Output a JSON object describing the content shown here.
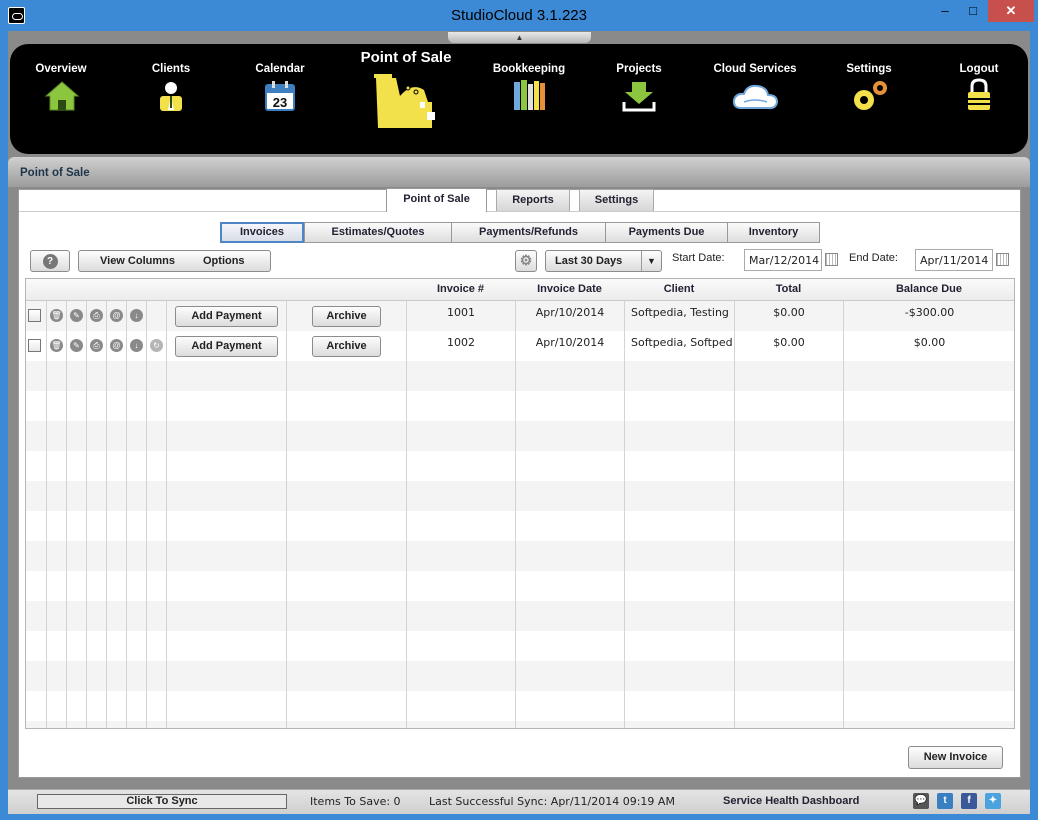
{
  "window": {
    "title": "StudioCloud 3.1.223",
    "minimize": "–",
    "maximize": "□",
    "close": "✕"
  },
  "nav": {
    "collapse_glyph": "▲",
    "items": [
      {
        "label": "Overview",
        "icon": "home-icon"
      },
      {
        "label": "Clients",
        "icon": "client-person-icon"
      },
      {
        "label": "Calendar",
        "icon": "calendar-icon",
        "day": "23"
      },
      {
        "label": "Point of Sale",
        "icon": "cash-register-icon",
        "active": true
      },
      {
        "label": "Bookkeeping",
        "icon": "books-icon"
      },
      {
        "label": "Projects",
        "icon": "download-tray-icon"
      },
      {
        "label": "Cloud Services",
        "icon": "cloud-icon"
      },
      {
        "label": "Settings",
        "icon": "gears-icon"
      },
      {
        "label": "Logout",
        "icon": "padlock-icon"
      }
    ]
  },
  "section": {
    "title": "Point of Sale"
  },
  "tabs": [
    {
      "label": "Point of Sale",
      "active": true
    },
    {
      "label": "Reports"
    },
    {
      "label": "Settings"
    }
  ],
  "subtabs": [
    {
      "label": "Invoices",
      "active": true
    },
    {
      "label": "Estimates/Quotes"
    },
    {
      "label": "Payments/Refunds"
    },
    {
      "label": "Payments Due"
    },
    {
      "label": "Inventory"
    }
  ],
  "toolbar": {
    "help": "?",
    "view_columns": "View Columns",
    "options": "Options",
    "gear": "⚙",
    "range": "Last 30 Days",
    "range_arrow": "▼",
    "start_label": "Start Date:",
    "start_value": "Mar/12/2014",
    "end_label": "End Date:",
    "end_value": "Apr/11/2014"
  },
  "table": {
    "columns": [
      "Invoice #",
      "Invoice Date",
      "Client",
      "Total",
      "Balance Due"
    ],
    "rows": [
      {
        "invoice": "1001",
        "date": "Apr/10/2014",
        "client": "Softpedia, Testing",
        "total": "$0.00",
        "balance": "-$300.00",
        "add_payment": "Add Payment",
        "archive": "Archive"
      },
      {
        "invoice": "1002",
        "date": "Apr/10/2014",
        "client": "Softpedia, Softpedia",
        "total": "$0.00",
        "balance": "$0.00",
        "add_payment": "Add Payment",
        "archive": "Archive"
      }
    ],
    "row_icons": [
      "trash-icon",
      "edit-pencil-icon",
      "print-icon",
      "email-at-icon",
      "download-icon",
      "refresh-icon"
    ]
  },
  "new_invoice": "New Invoice",
  "status": {
    "sync_button": "Click To Sync",
    "items_to_save": "Items To Save: 0",
    "last_sync": "Last Successful Sync: Apr/11/2014 09:19 AM",
    "health": "Service Health Dashboard",
    "social": [
      {
        "icon": "chat-bubble-icon",
        "glyph": "💬",
        "color": "#555555"
      },
      {
        "icon": "twitter-icon",
        "glyph": "t",
        "color": "#3a7fc2"
      },
      {
        "icon": "facebook-icon",
        "glyph": "f",
        "color": "#3b5998"
      },
      {
        "icon": "share-icon",
        "glyph": "✦",
        "color": "#4aa3df"
      }
    ]
  },
  "colors": {
    "accent": "#3c8ad6",
    "nav_bg": "#000000",
    "icon_yellow": "#f2e14a",
    "icon_green": "#8cc63f",
    "active_tab_border": "#4e86c5"
  }
}
